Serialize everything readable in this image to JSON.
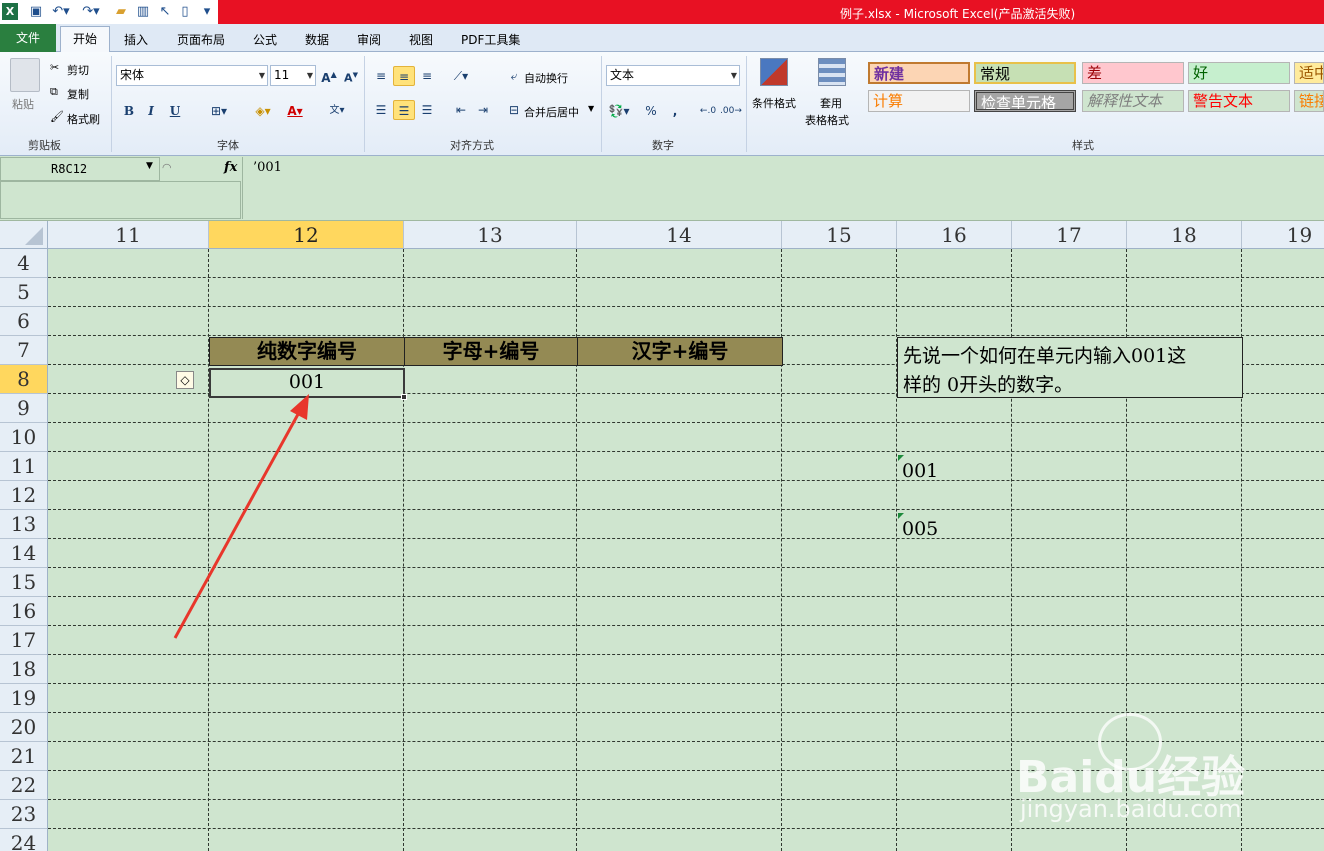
{
  "window": {
    "title": "例子.xlsx - Microsoft Excel(产品激活失败)"
  },
  "ribbon_tabs": [
    "文件",
    "开始",
    "插入",
    "页面布局",
    "公式",
    "数据",
    "审阅",
    "视图",
    "PDF工具集"
  ],
  "clipboard": {
    "paste": "粘贴",
    "cut": "剪切",
    "copy": "复制",
    "format_painter": "格式刷",
    "label": "剪贴板"
  },
  "font": {
    "name": "宋体",
    "size": "11",
    "bold": "B",
    "italic": "I",
    "underline": "U",
    "label": "字体"
  },
  "alignment": {
    "wrap": "自动换行",
    "merge": "合并后居中",
    "label": "对齐方式"
  },
  "number": {
    "format": "文本",
    "percent": "%",
    "comma": ",",
    "label": "数字"
  },
  "styles_group": {
    "conditional": "条件格式",
    "table_format_1": "套用",
    "table_format_2": "表格格式",
    "label": "样式",
    "cells": [
      {
        "text": "新建",
        "bg": "#fcd5b4",
        "color": "#7030a0"
      },
      {
        "text": "常规",
        "bg": "#c6e0b4",
        "color": "#000000"
      },
      {
        "text": "差",
        "bg": "#ffc7ce",
        "color": "#9c0006"
      },
      {
        "text": "好",
        "bg": "#c6efce",
        "color": "#006100"
      },
      {
        "text": "适中",
        "bg": "#ffeb9c",
        "color": "#9c5700"
      },
      {
        "text": "计算",
        "bg": "#f2f2f2",
        "color": "#fa7d00"
      },
      {
        "text": "检查单元格",
        "bg": "#a5a5a5",
        "color": "#ffffff"
      },
      {
        "text": "解释性文本",
        "bg": "#cfe5cf",
        "color": "#7f7f7f"
      },
      {
        "text": "警告文本",
        "bg": "#cfe5cf",
        "color": "#ff0000"
      },
      {
        "text": "链接",
        "bg": "#cfe5cf",
        "color": "#fa7d00"
      }
    ]
  },
  "formula_bar": {
    "name_box": "R8C12",
    "fx": "fx",
    "content": "’001"
  },
  "columns": [
    "11",
    "12",
    "13",
    "14",
    "15",
    "16",
    "17",
    "18",
    "19"
  ],
  "rows": [
    "4",
    "5",
    "6",
    "7",
    "8",
    "9",
    "10",
    "11",
    "12",
    "13",
    "14",
    "15",
    "16",
    "17",
    "18",
    "19",
    "20",
    "21",
    "22",
    "23",
    "24"
  ],
  "sheet": {
    "headers": [
      "纯数字编号",
      "字母+编号",
      "汉字+编号"
    ],
    "selected_value": "001",
    "note_line1": "先说一个如何在单元内输入001这",
    "note_line2": "样的 0开头的数字。",
    "value_r11": "001",
    "value_r13": "005"
  },
  "watermark": {
    "brand": "Baidu经验",
    "url": "jingyan.baidu.com"
  }
}
